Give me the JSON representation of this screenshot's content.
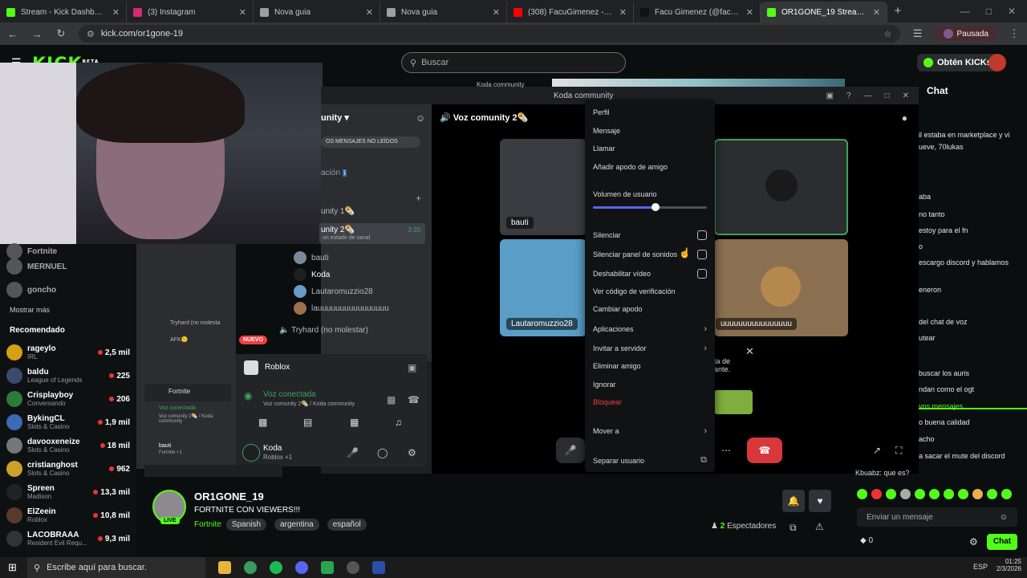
{
  "browser": {
    "tabs": [
      {
        "label": "Stream - Kick Dashboard",
        "color": "#53fc18"
      },
      {
        "label": "(3) Instagram",
        "color": "#d62976"
      },
      {
        "label": "Nova guia",
        "color": "#9aa0a6"
      },
      {
        "label": "Nova guia",
        "color": "#9aa0a6"
      },
      {
        "label": "(308) FacuGimenez - YouTube",
        "color": "#ff0000"
      },
      {
        "label": "Facu Gimenez (@facu.g1menez",
        "color": "#111111"
      },
      {
        "label": "OR1GONE_19 Stream - Wat",
        "color": "#53fc18"
      }
    ],
    "new_tab": "+",
    "url": "kick.com/or1gone-19",
    "profile_label": "Pausada"
  },
  "kick": {
    "logo": "KICK",
    "logo_beta": "BETA",
    "search_placeholder": "Buscar",
    "get_kicks": "Obtén KICKs"
  },
  "sidebar": {
    "top_items": [
      {
        "name": "Fortnite",
        "game": "",
        "viewers": ""
      },
      {
        "name": "MERNUEL",
        "game": "",
        "viewers": ""
      },
      {
        "name": "goncho",
        "game": "",
        "viewers": ""
      }
    ],
    "show_more": "Mostrar más",
    "recommended_title": "Recomendado",
    "recommended": [
      {
        "name": "rageylo",
        "game": "IRL",
        "viewers": "2,5 mil",
        "color": "#d4a017"
      },
      {
        "name": "baldu",
        "game": "League of Legends",
        "viewers": "225",
        "color": "#3a4a6b"
      },
      {
        "name": "Crisplayboy",
        "game": "Conversando",
        "viewers": "206",
        "color": "#2d7a3a"
      },
      {
        "name": "BykingCL",
        "game": "Slots & Casino",
        "viewers": "1,9 mil",
        "color": "#3a6bb3"
      },
      {
        "name": "davooxeneize",
        "game": "Slots & Casino",
        "viewers": "18 mil",
        "color": "#777777"
      },
      {
        "name": "cristianghost",
        "game": "Slots & Casino",
        "viewers": "962",
        "color": "#c9a227"
      },
      {
        "name": "Spreen",
        "game": "Madison",
        "viewers": "13,3 mil",
        "color": "#222222"
      },
      {
        "name": "ElZeein",
        "game": "Roblox",
        "viewers": "10,8 mil",
        "color": "#5a3a2a"
      },
      {
        "name": "LACOBRAAA",
        "game": "Resident Evil Requ...",
        "viewers": "9,3 mil",
        "color": "#333333"
      }
    ]
  },
  "discord": {
    "title": "Koda community",
    "server_name": "Koda community",
    "voice_channel_header": "Voz comunity 2🌯",
    "unread_label": "OS MENSAJES NO LEÍDOS",
    "channels": [
      "unity 1🌯",
      "unity 2🌯"
    ],
    "channel_time": "3:20",
    "channel_status": "un estado de canal",
    "members": [
      "bauti",
      "Koda",
      "Lautaromuzzio28",
      "lauuuuuuuuuuuuuuuu"
    ],
    "tryhard": "Tryhard (no molestar)",
    "tiles": [
      {
        "label": "bauti"
      },
      {
        "label": "Lautaromuzzio28"
      },
      {
        "label": "uuuuuuuuuuuuuuuu"
      }
    ],
    "activity_name": "Roblox",
    "voice_connected": "Voz conectada",
    "voice_connected_sub": "Voz comunity 2🌯 / Koda community",
    "user_name": "Koda",
    "user_status": "Roblox +1",
    "nuevo_badge": "NUEVO",
    "popup_text": "ta de\nante.",
    "mini_labels": [
      "Fortnite",
      "Voz conectada",
      "Voz comunity 2🌯 / Koda community",
      "bauti",
      "Fortnite +1",
      "Tryhard (no molesta",
      "AFK🙁"
    ]
  },
  "context_menu": {
    "items": [
      {
        "label": "Perfil",
        "type": "item"
      },
      {
        "label": "Mensaje",
        "type": "item"
      },
      {
        "label": "Llamar",
        "type": "item"
      },
      {
        "label": "Añadir apodo de amigo",
        "type": "item"
      }
    ],
    "volume_label": "Volumen de usuario",
    "volume_fraction": 0.55,
    "toggles": [
      {
        "label": "Silenciar",
        "checked": false
      },
      {
        "label": "Silenciar panel de sonidos",
        "checked": false
      },
      {
        "label": "Deshabilitar vídeo",
        "checked": false
      }
    ],
    "items2": [
      {
        "label": "Ver código de verificación",
        "sub": false
      },
      {
        "label": "Cambiar apodo",
        "sub": false
      },
      {
        "label": "Aplicaciones",
        "sub": true
      },
      {
        "label": "Invitar a servidor",
        "sub": true
      },
      {
        "label": "Eliminar amigo",
        "sub": false
      },
      {
        "label": "Ignorar",
        "sub": false
      },
      {
        "label": "Bloquear",
        "sub": false,
        "danger": true
      },
      {
        "label": "Mover a",
        "sub": true
      },
      {
        "label": "Separar usuario",
        "sub": false
      }
    ]
  },
  "chat": {
    "title": "Chat",
    "lines": [
      "il estaba en marketplace y vi",
      "ueve, 70lukas",
      "aba",
      "no tanto",
      "estoy para el fn",
      "o",
      "escargo discord y hablamos",
      "eneron",
      "del chat de voz",
      "utear",
      "buscar los auris",
      "ndan como el ogt",
      "vos mensajes",
      "o buena calidad",
      "acho",
      "a sacar el mute del discord"
    ],
    "last_user_line": "Kbuabz: que es?",
    "input_placeholder": "Enviar un mensaje",
    "points": "0",
    "send_label": "Chat"
  },
  "stream": {
    "channel": "OR1GONE_19",
    "title": "FORTNITE CON VIEWERS!!!",
    "category": "Fortnite",
    "tags": [
      "Spanish",
      "argentina",
      "español"
    ],
    "live": "LIVE",
    "viewers_count": "2",
    "viewers_label": "Espectadores"
  },
  "taskbar": {
    "search_text": "Escribe aquí para buscar.",
    "lang": "ESP",
    "time": "01:25",
    "date": "2/3/2026"
  }
}
